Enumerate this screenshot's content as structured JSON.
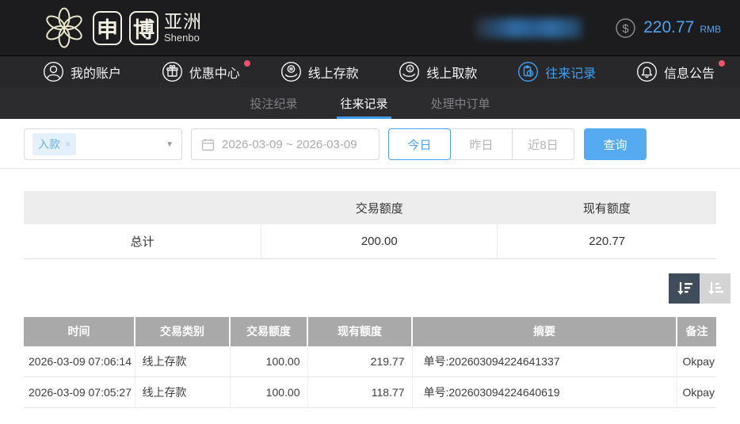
{
  "header": {
    "logo": {
      "char1": "申",
      "char2": "博",
      "region": "亚洲",
      "subtitle": "Shenbo"
    },
    "balance": {
      "amount": "220.77",
      "currency": "RMB"
    }
  },
  "nav": {
    "items": [
      {
        "label": "我的账户",
        "icon": "user-icon",
        "active": false,
        "badge": false
      },
      {
        "label": "优惠中心",
        "icon": "gift-icon",
        "active": false,
        "badge": true
      },
      {
        "label": "线上存款",
        "icon": "deposit-icon",
        "active": false,
        "badge": false
      },
      {
        "label": "线上取款",
        "icon": "withdraw-icon",
        "active": false,
        "badge": false
      },
      {
        "label": "往来记录",
        "icon": "records-icon",
        "active": true,
        "badge": false
      },
      {
        "label": "信息公告",
        "icon": "bell-icon",
        "active": false,
        "badge": true
      }
    ]
  },
  "subnav": {
    "tabs": [
      {
        "label": "投注纪录",
        "active": false
      },
      {
        "label": "往来记录",
        "active": true
      },
      {
        "label": "处理中订单",
        "active": false
      }
    ]
  },
  "filters": {
    "type_select": {
      "selected_tag": "入款",
      "remove_label": "×",
      "caret": "▼"
    },
    "date_range": "2026-03-09 ~ 2026-03-09",
    "quick_ranges": [
      {
        "label": "今日",
        "active": true
      },
      {
        "label": "昨日",
        "active": false
      },
      {
        "label": "近8日",
        "active": false
      }
    ],
    "search_label": "查询"
  },
  "summary": {
    "columns": [
      "",
      "交易额度",
      "现有额度"
    ],
    "row": {
      "label": "总计",
      "transaction_amount": "200.00",
      "current_balance": "220.77"
    }
  },
  "records": {
    "columns": [
      "时间",
      "交易类别",
      "交易额度",
      "现有额度",
      "摘要",
      "备注"
    ],
    "rows": [
      {
        "time": "2026-03-09 07:06:14",
        "type": "线上存款",
        "amount": "100.00",
        "balance": "219.77",
        "summary": "单号:202603094224641337",
        "remark": "Okpay"
      },
      {
        "time": "2026-03-09 07:05:27",
        "type": "线上存款",
        "amount": "100.00",
        "balance": "118.77",
        "summary": "单号:202603094224640619",
        "remark": "Okpay"
      }
    ]
  },
  "colors": {
    "accent": "#3f9ef2",
    "button": "#55aaf0",
    "badge": "#f2506b",
    "table_header_bg": "#a9a9a9",
    "header_bg": "#1c1c1e",
    "logo_cream": "#e9e5cc"
  }
}
